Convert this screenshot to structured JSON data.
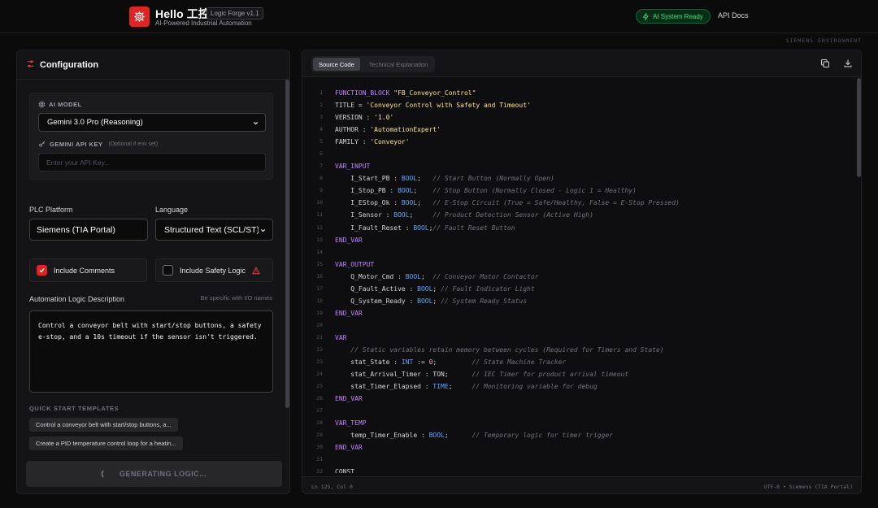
{
  "header": {
    "brand_title": "Hello 工控",
    "badge": "Logic Forge v1.1",
    "subtitle": "AI-Powered Industrial Automation",
    "ai_status": "AI System Ready",
    "api_docs": "API Docs",
    "environment": "SIEMENS ENVIRONMENT"
  },
  "colors": {
    "accent": "#dc2626",
    "status_green": "#4ade80"
  },
  "config": {
    "title": "Configuration",
    "ai_model_label": "AI MODEL",
    "ai_model_value": "Gemini 3.0 Pro (Reasoning)",
    "api_key_label": "GEMINI API KEY",
    "api_key_optional": "(Optional if env set)",
    "api_key_placeholder": "Enter your API Key...",
    "platform_label": "PLC Platform",
    "platform_value": "Siemens (TIA Portal)",
    "language_label": "Language",
    "language_value": "Structured Text (SCL/ST)",
    "include_comments": "Include Comments",
    "include_comments_checked": true,
    "include_safety": "Include Safety Logic",
    "include_safety_checked": false,
    "desc_label": "Automation Logic Description",
    "desc_hint": "Be specific with I/O names",
    "description": "Control a conveyor belt with start/stop buttons, a safety e-stop, and a 10s timeout if the sensor isn't triggered.",
    "quick_start_label": "QUICK START TEMPLATES",
    "templates": [
      "Control a conveyor belt with start/stop buttons, a...",
      "Create a PID temperature control loop for a heatin..."
    ],
    "generate_label": "GENERATING LOGIC..."
  },
  "editor": {
    "tab_source": "Source Code",
    "tab_explanation": "Technical Explanation",
    "status_left": "Ln 125, Col 0",
    "status_right": "UTF-8 • Siemens (TIA Portal)",
    "lines": [
      [
        [
          "kw",
          "FUNCTION_BLOCK"
        ],
        [
          "p",
          " "
        ],
        [
          "str",
          "\"FB_Conveyor_Control\""
        ]
      ],
      [
        [
          "p",
          "TITLE = "
        ],
        [
          "str",
          "'Conveyor Control with Safety and Timeout'"
        ]
      ],
      [
        [
          "p",
          "VERSION : "
        ],
        [
          "str",
          "'1.0'"
        ]
      ],
      [
        [
          "p",
          "AUTHOR : "
        ],
        [
          "str",
          "'AutomationExpert'"
        ]
      ],
      [
        [
          "p",
          "FAMILY : "
        ],
        [
          "str",
          "'Conveyor'"
        ]
      ],
      [],
      [
        [
          "kw",
          "VAR_INPUT"
        ]
      ],
      [
        [
          "p",
          "    I_Start_PB : "
        ],
        [
          "ty",
          "BOOL"
        ],
        [
          "p",
          ";   "
        ],
        [
          "cm",
          "// Start Button (Normally Open)"
        ]
      ],
      [
        [
          "p",
          "    I_Stop_PB : "
        ],
        [
          "ty",
          "BOOL"
        ],
        [
          "p",
          ";    "
        ],
        [
          "cm",
          "// Stop Button (Normally Closed - Logic 1 = Healthy)"
        ]
      ],
      [
        [
          "p",
          "    I_EStop_Ok : "
        ],
        [
          "ty",
          "BOOL"
        ],
        [
          "p",
          ";   "
        ],
        [
          "cm",
          "// E-Stop Circuit (True = Safe/Healthy, False = E-Stop Pressed)"
        ]
      ],
      [
        [
          "p",
          "    I_Sensor : "
        ],
        [
          "ty",
          "BOOL"
        ],
        [
          "p",
          ";     "
        ],
        [
          "cm",
          "// Product Detection Sensor (Active High)"
        ]
      ],
      [
        [
          "p",
          "    I_Fault_Reset : "
        ],
        [
          "ty",
          "BOOL"
        ],
        [
          "p",
          ";"
        ],
        [
          "cm",
          "// Fault Reset Button"
        ]
      ],
      [
        [
          "kw",
          "END_VAR"
        ]
      ],
      [],
      [
        [
          "kw",
          "VAR_OUTPUT"
        ]
      ],
      [
        [
          "p",
          "    Q_Motor_Cmd : "
        ],
        [
          "ty",
          "BOOL"
        ],
        [
          "p",
          ";  "
        ],
        [
          "cm",
          "// Conveyor Motor Contactor"
        ]
      ],
      [
        [
          "p",
          "    Q_Fault_Active : "
        ],
        [
          "ty",
          "BOOL"
        ],
        [
          "p",
          "; "
        ],
        [
          "cm",
          "// Fault Indicator Light"
        ]
      ],
      [
        [
          "p",
          "    Q_System_Ready : "
        ],
        [
          "ty",
          "BOOL"
        ],
        [
          "p",
          "; "
        ],
        [
          "cm",
          "// System Ready Status"
        ]
      ],
      [
        [
          "kw",
          "END_VAR"
        ]
      ],
      [],
      [
        [
          "kw",
          "VAR"
        ]
      ],
      [
        [
          "p",
          "    "
        ],
        [
          "cm",
          "// Static variables retain memory between cycles (Required for Timers and State)"
        ]
      ],
      [
        [
          "p",
          "    stat_State : "
        ],
        [
          "ty",
          "INT"
        ],
        [
          "p",
          " := "
        ],
        [
          "num",
          "0"
        ],
        [
          "p",
          ";         "
        ],
        [
          "cm",
          "// State Machine Tracker"
        ]
      ],
      [
        [
          "p",
          "    stat_Arrival_Timer : TON;      "
        ],
        [
          "cm",
          "// IEC Timer for product arrival timeout"
        ]
      ],
      [
        [
          "p",
          "    stat_Timer_Elapsed : "
        ],
        [
          "ty",
          "TIME"
        ],
        [
          "p",
          ";     "
        ],
        [
          "cm",
          "// Monitoring variable for debug"
        ]
      ],
      [
        [
          "kw",
          "END_VAR"
        ]
      ],
      [],
      [
        [
          "kw",
          "VAR_TEMP"
        ]
      ],
      [
        [
          "p",
          "    temp_Timer_Enable : "
        ],
        [
          "ty",
          "BOOL"
        ],
        [
          "p",
          ";      "
        ],
        [
          "cm",
          "// Temporary logic for timer trigger"
        ]
      ],
      [
        [
          "kw",
          "END_VAR"
        ]
      ],
      [],
      [
        [
          "p",
          "CONST"
        ]
      ]
    ]
  }
}
